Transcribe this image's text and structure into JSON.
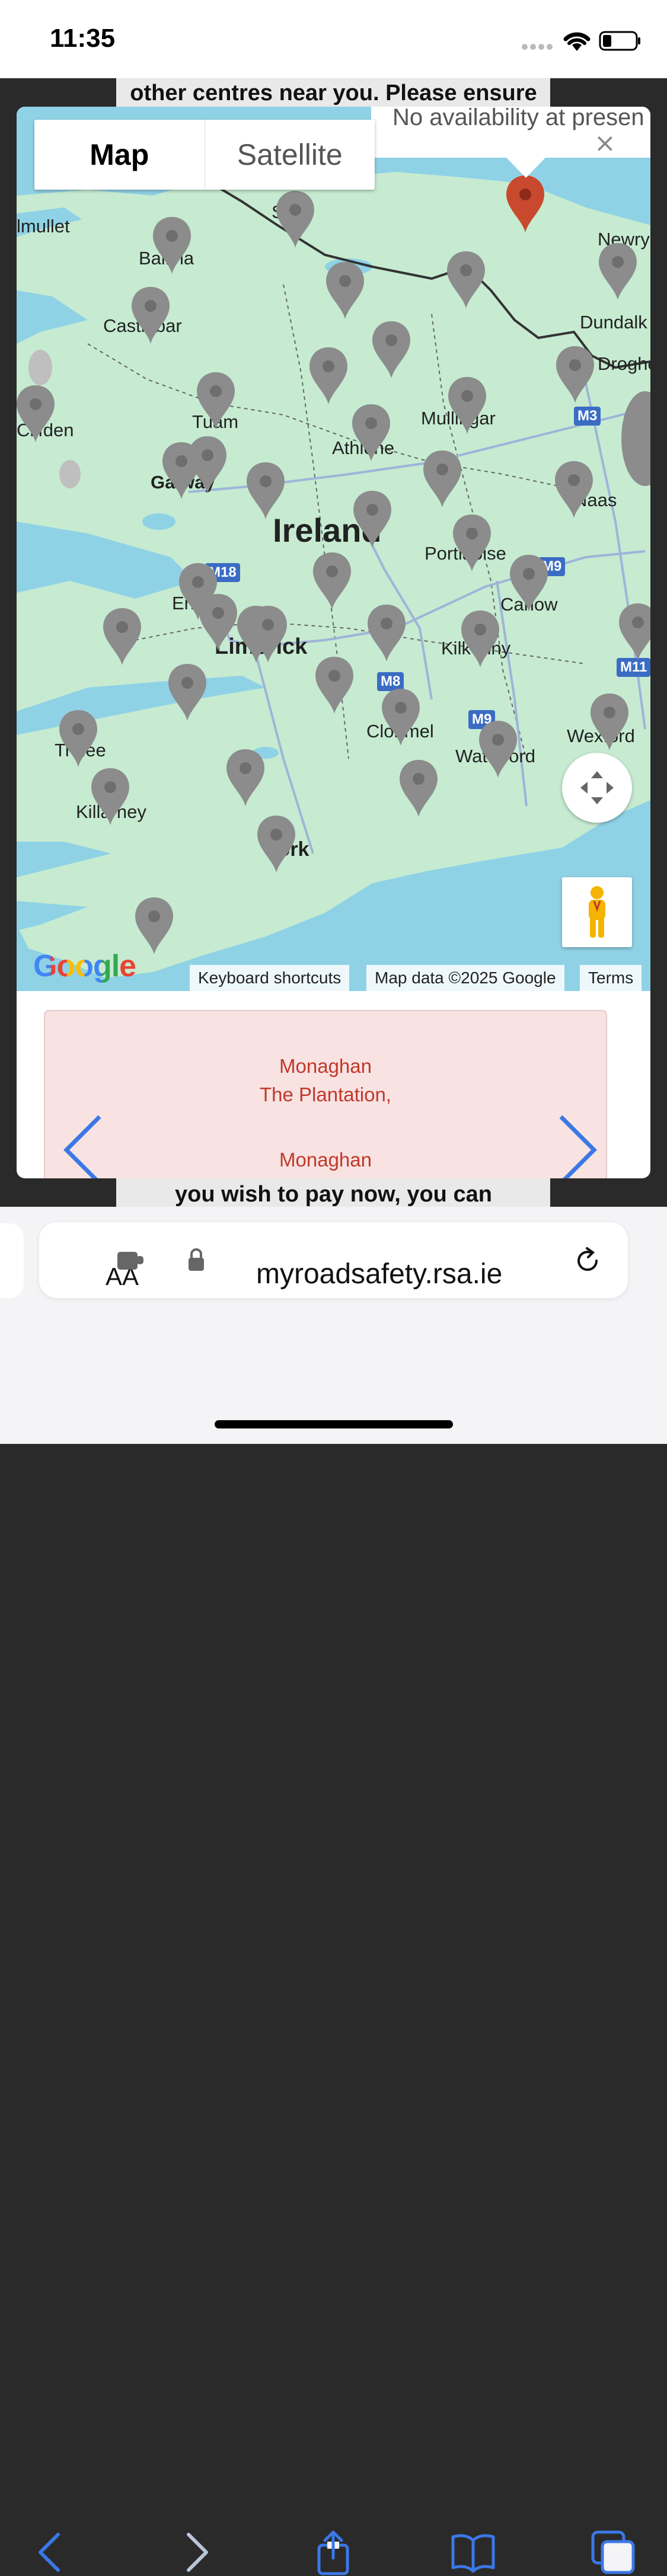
{
  "status_bar": {
    "time": "11:35"
  },
  "background_page": {
    "top_text": "other centres near you. Please ensure",
    "bottom_text": "you wish to pay now, you can"
  },
  "map": {
    "map_type": {
      "map_label": "Map",
      "satellite_label": "Satellite",
      "selected": "Map"
    },
    "info_window": {
      "text": "No availability at presen",
      "close_symbol": "×"
    },
    "place_labels": [
      {
        "text": "lmullet"
      },
      {
        "text": "Ballina"
      },
      {
        "text": "Sligo"
      },
      {
        "text": "Castlebar"
      },
      {
        "text": "Newry"
      },
      {
        "text": "Dundalk"
      },
      {
        "text": "Drogheda"
      },
      {
        "text": "Tuam"
      },
      {
        "text": "Athlone"
      },
      {
        "text": "Mullingar"
      },
      {
        "text": "Galway"
      },
      {
        "text": "Ireland"
      },
      {
        "text": "Portlaoise"
      },
      {
        "text": "Naas"
      },
      {
        "text": "Carlow"
      },
      {
        "text": "Ennis"
      },
      {
        "text": "Limerick"
      },
      {
        "text": "Kilkenny"
      },
      {
        "text": "Clonmel"
      },
      {
        "text": "Waterford"
      },
      {
        "text": "Wexford"
      },
      {
        "text": "Tralee"
      },
      {
        "text": "Killarney"
      },
      {
        "text": "Cork"
      },
      {
        "text": "Clifden"
      }
    ],
    "road_shields": [
      {
        "text": "M18"
      },
      {
        "text": "M3"
      },
      {
        "text": "M9"
      },
      {
        "text": "M8"
      },
      {
        "text": "M9"
      },
      {
        "text": "M11"
      }
    ],
    "google_logo": "Google",
    "attribution": {
      "keyboard_shortcuts": "Keyboard shortcuts",
      "map_data": "Map data ©2025 Google",
      "terms": "Terms"
    },
    "colors": {
      "land": "#c6ebd1",
      "water": "#8fd2e6",
      "marker_selected": "#c9492f",
      "marker": "#8c8c8c"
    }
  },
  "centre_card": {
    "line1": "Monaghan",
    "line2": "The Plantation,",
    "line3": "Monaghan"
  },
  "browser": {
    "aa_label": "AA",
    "url": "myroadsafety.rsa.ie"
  }
}
